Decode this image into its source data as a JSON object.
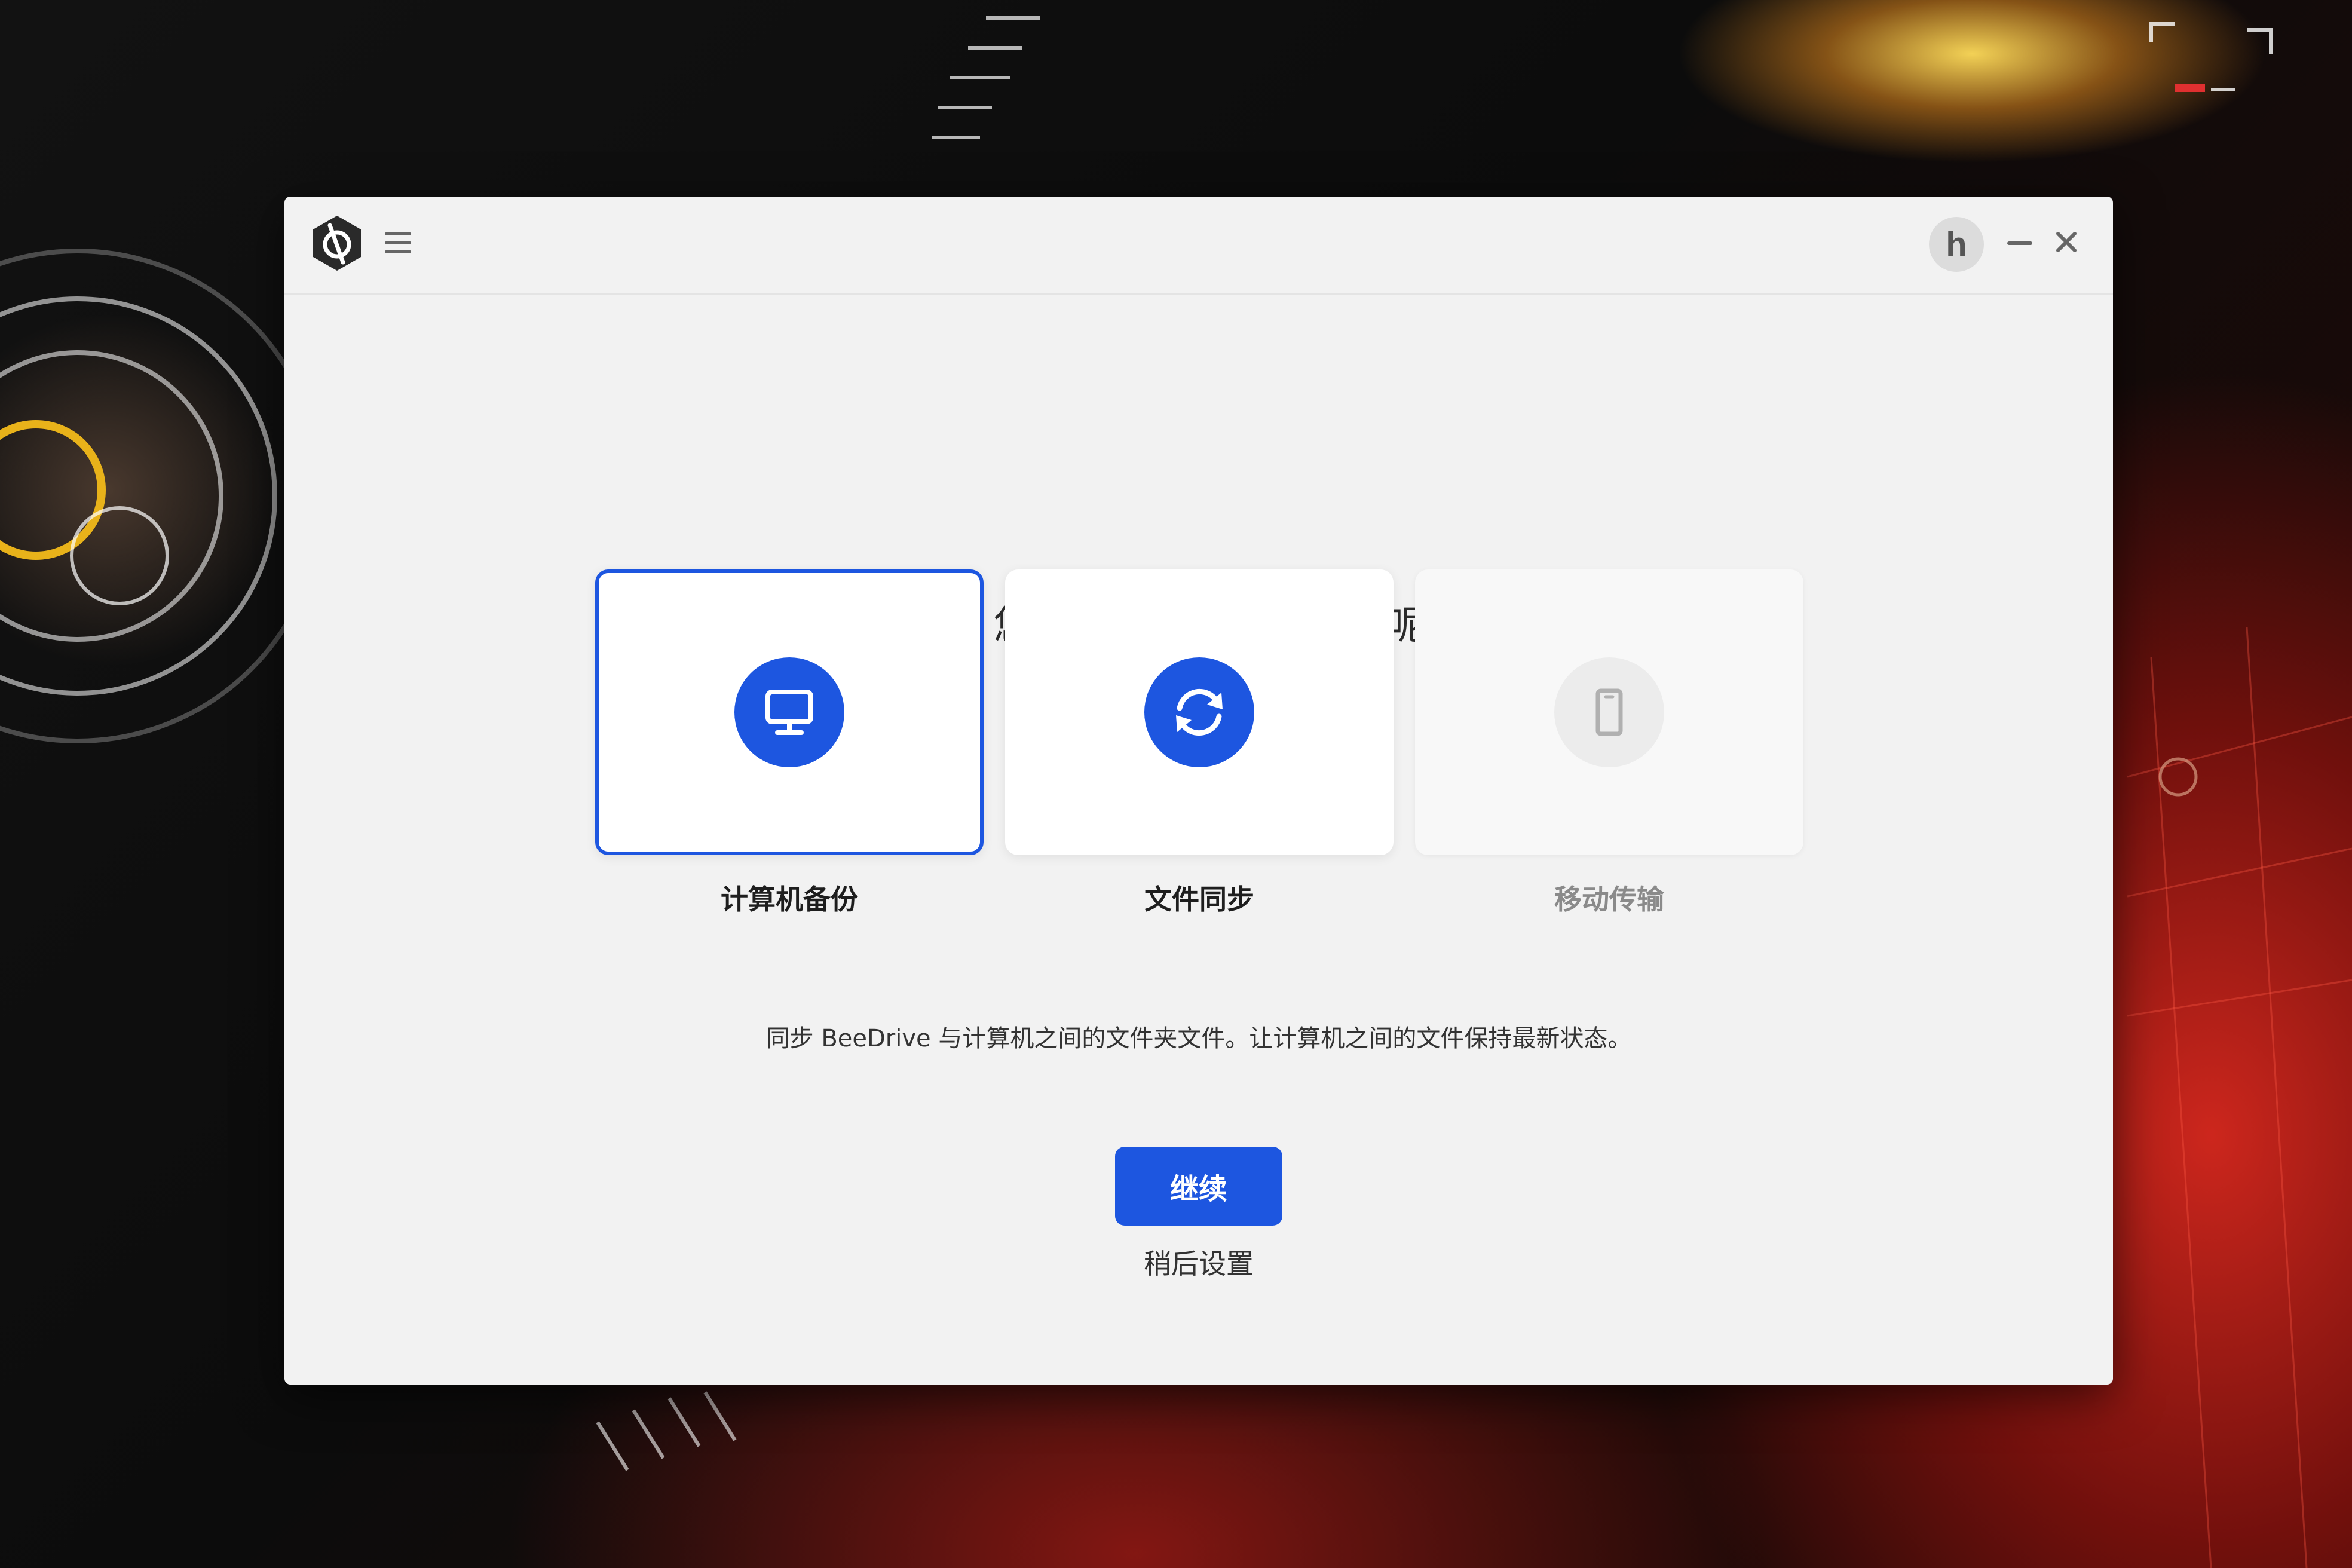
{
  "window": {
    "user_avatar_letter": "h",
    "icons": {
      "logo": "beedrive-logo-icon",
      "menu": "hamburger-menu-icon",
      "minimize": "minimize-icon",
      "close": "close-icon"
    }
  },
  "main": {
    "greeting": "hu 您好，今天想设置什么呢？",
    "options": [
      {
        "label": "计算机备份",
        "icon": "monitor-icon",
        "selected": true,
        "enabled": true
      },
      {
        "label": "文件同步",
        "icon": "sync-icon",
        "selected": false,
        "enabled": true
      },
      {
        "label": "移动传输",
        "icon": "mobile-phone-icon",
        "selected": false,
        "enabled": false
      }
    ],
    "description": "同步 BeeDrive 与计算机之间的文件夹文件。让计算机之间的文件保持最新状态。",
    "continue_label": "继续",
    "later_label": "稍后设置"
  },
  "colors": {
    "accent": "#1d56e0",
    "window_bg": "#f2f2f2",
    "card_bg": "#ffffff",
    "disabled_text": "#8a8a8a"
  }
}
